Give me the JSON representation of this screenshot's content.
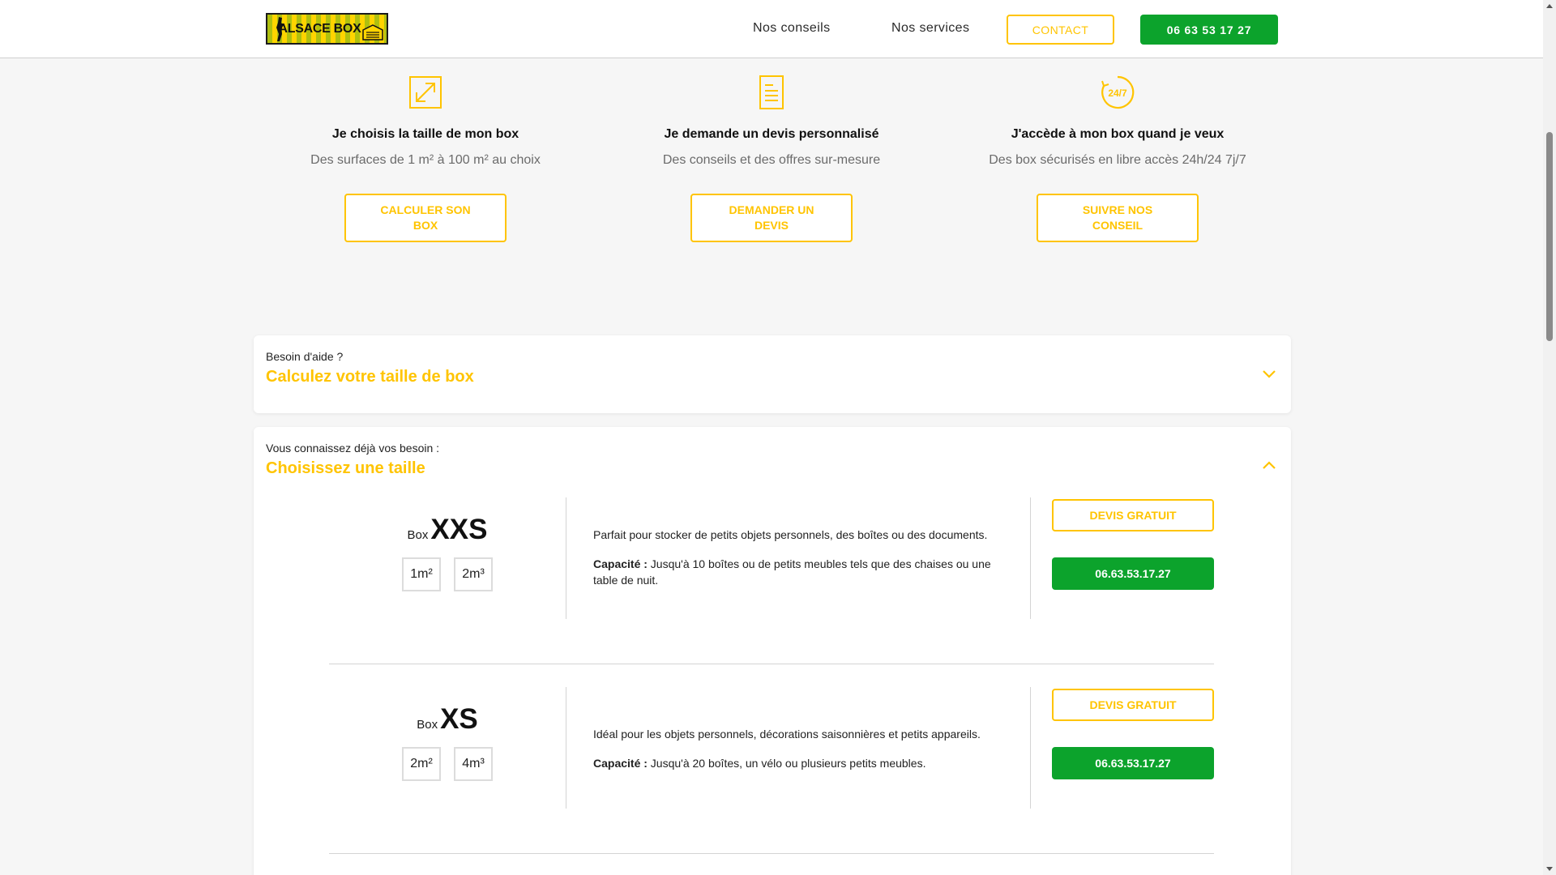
{
  "colors": {
    "accent_yellow": "#ffc400",
    "cta_green": "#0ca32c",
    "page_bg": "#f6f6f6"
  },
  "header": {
    "logo_text": "ALSACE BOX",
    "nav": {
      "conseils": "Nos conseils",
      "services": "Nos services"
    },
    "contact_label": "CONTACT",
    "phone_label": "06 63 53 17 27"
  },
  "features": [
    {
      "icon": "resize-arrow-icon",
      "title": "Je choisis la taille de mon box",
      "subtitle": "Des surfaces de 1 m² à 100 m² au choix",
      "button": "CALCULER SON BOX"
    },
    {
      "icon": "document-icon",
      "title": "Je demande un devis personnalisé",
      "subtitle": "Des conseils et des offres sur-mesure",
      "button": "DEMANDER UN DEVIS"
    },
    {
      "icon": "clock-24-7-icon",
      "icon_text": "24/7",
      "title": "J'accède à mon box quand je veux",
      "subtitle": "Des box sécurisés en libre accès 24h/24 7j/7",
      "button": "SUIVRE NOS CONSEIL"
    }
  ],
  "help_card": {
    "kicker": "Besoin d'aide ?",
    "title": "Calculez votre taille de box",
    "toggle_icon": "chevron-down-icon"
  },
  "choose_card": {
    "kicker": "Vous connaissez déjà vos besoin :",
    "title": "Choisissez une taille",
    "toggle_icon": "chevron-up-icon",
    "boxes": [
      {
        "prefix": "Box",
        "size": "XXS",
        "surface": "1m²",
        "volume": "2m³",
        "description": "Parfait pour stocker de petits objets personnels, des boîtes ou des documents.",
        "capacity_label": "Capacité :",
        "capacity_text": " Jusqu'à 10 boîtes ou de petits meubles tels que des chaises ou une table de nuit.",
        "devis_label": "DEVIS GRATUIT",
        "phone_label": "06.63.53.17.27"
      },
      {
        "prefix": "Box",
        "size": "XS",
        "surface": "2m²",
        "volume": "4m³",
        "description": "Idéal pour les objets personnels, décorations saisonnières et petits appareils.",
        "capacity_label": "Capacité :",
        "capacity_text": " Jusqu'à 20 boîtes, un vélo ou plusieurs petits meubles.",
        "devis_label": "DEVIS GRATUIT",
        "phone_label": "06.63.53.17.27"
      }
    ]
  }
}
